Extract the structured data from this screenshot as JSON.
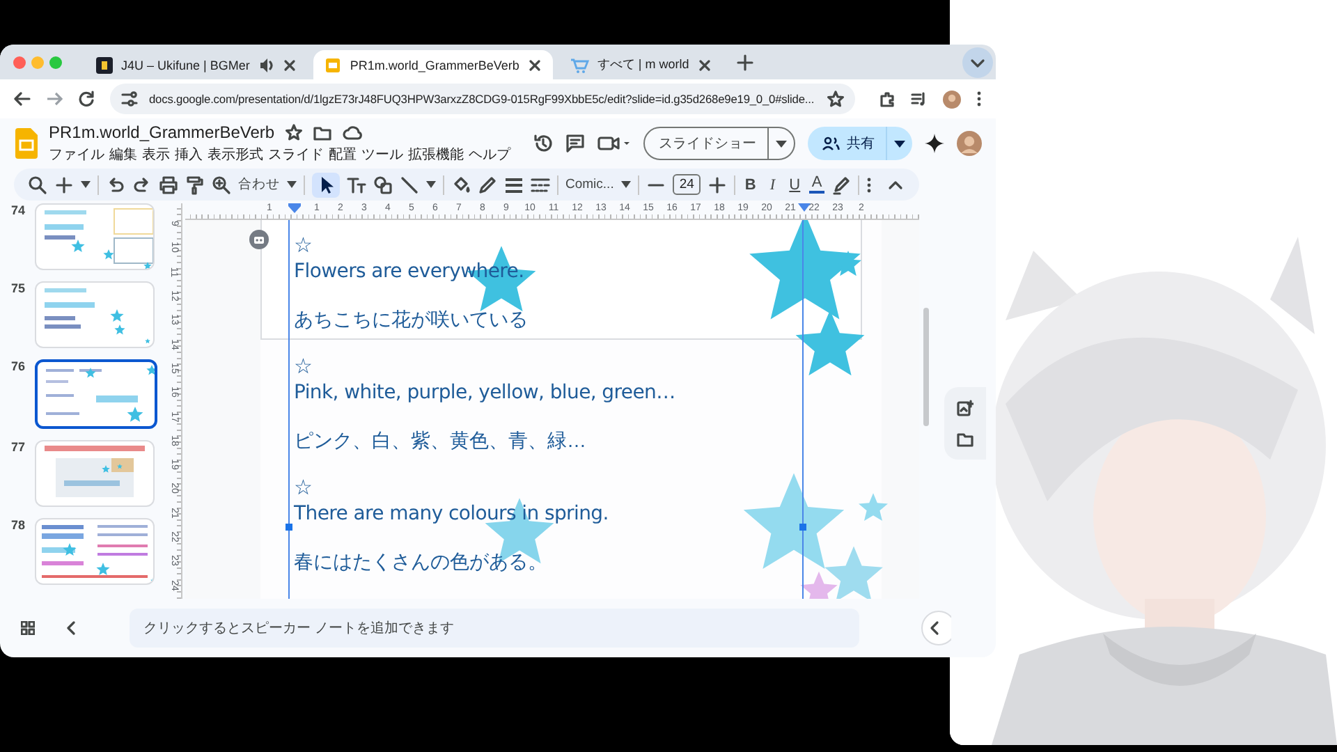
{
  "browser": {
    "tabs": [
      {
        "kind": "music",
        "title": "J4U – Ukifune | BGMer",
        "audio": true,
        "selected": false
      },
      {
        "kind": "slides",
        "title": "PR1m.world_GrammerBeVerb",
        "audio": false,
        "selected": true
      },
      {
        "kind": "shop",
        "title": "すべて | m world",
        "audio": false,
        "selected": false
      }
    ],
    "url": "docs.google.com/presentation/d/1lgzE73rJ48FUQ3HPW3arxzZ8CDG9-015RgF99XbbE5c/edit?slide=id.g35d268e9e19_0_0#slide..."
  },
  "document": {
    "title": "PR1m.world_GrammerBeVerb",
    "menu": [
      "ファイル",
      "編集",
      "表示",
      "挿入",
      "表示形式",
      "スライド",
      "配置",
      "ツール",
      "拡張機能",
      "ヘルプ"
    ],
    "slideshow_button": "スライドショー",
    "share_button": "共有"
  },
  "toolbar": {
    "zoom": "合わせ",
    "font": "Comic...",
    "font_size": "24",
    "format_buttons": [
      "B",
      "I",
      "U",
      "A"
    ]
  },
  "filmstrip": [
    {
      "number": "74",
      "selected": false
    },
    {
      "number": "75",
      "selected": false
    },
    {
      "number": "76",
      "selected": true
    },
    {
      "number": "77",
      "selected": false
    },
    {
      "number": "78",
      "selected": false
    }
  ],
  "ruler": {
    "horizontal": [
      "1",
      "1",
      "2",
      "3",
      "4",
      "5",
      "6",
      "7",
      "8",
      "9",
      "10",
      "11",
      "12",
      "13",
      "14",
      "15",
      "16",
      "17",
      "18",
      "19",
      "20",
      "21",
      "22",
      "23",
      "2"
    ],
    "vertical": [
      "9",
      "10",
      "11",
      "12",
      "13",
      "14",
      "15",
      "16",
      "17",
      "18",
      "19",
      "20",
      "21",
      "22",
      "23",
      "24"
    ]
  },
  "slide": {
    "lines": [
      {
        "kind": "mark",
        "text": "☆"
      },
      {
        "kind": "english",
        "text": "Flowers are everywhere."
      },
      {
        "kind": "japanese",
        "text": "あちこちに花が咲いている"
      },
      {
        "kind": "mark",
        "text": "☆"
      },
      {
        "kind": "english",
        "text": "Pink, white, purple, yellow, blue, green…"
      },
      {
        "kind": "japanese",
        "text": "ピンク、白、紫、黄色、青、緑…"
      },
      {
        "kind": "mark",
        "text": "☆"
      },
      {
        "kind": "english",
        "text": "There are many colours in spring."
      },
      {
        "kind": "japanese",
        "text": "春にはたくさんの色がある。"
      }
    ]
  },
  "notes": {
    "placeholder": "クリックするとスピーカー ノートを追加できます"
  }
}
